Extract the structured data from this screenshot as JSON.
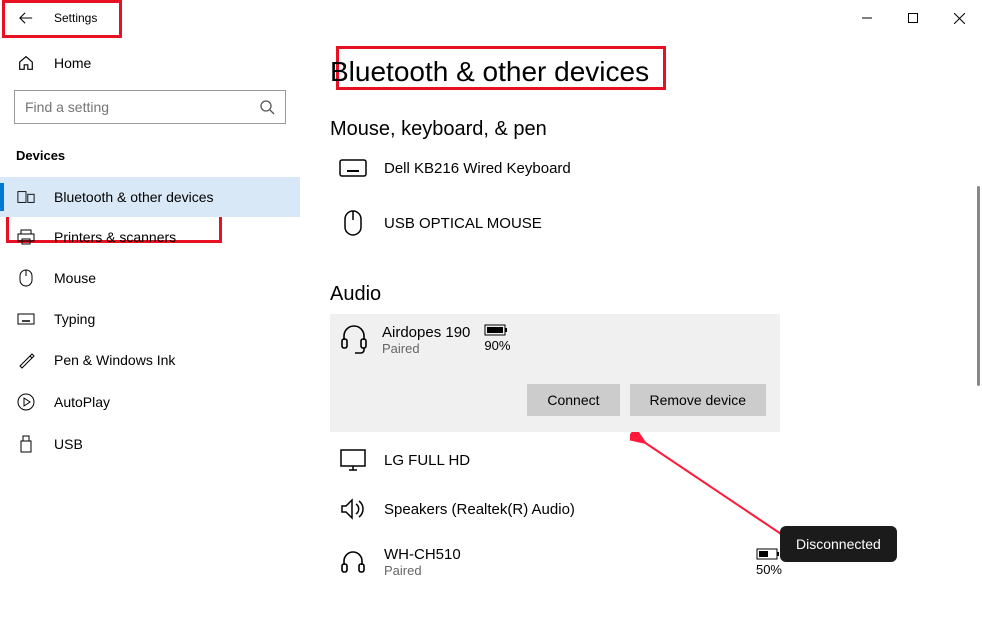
{
  "titlebar": {
    "title": "Settings"
  },
  "sidebar": {
    "home": "Home",
    "search_placeholder": "Find a setting",
    "section": "Devices",
    "items": [
      {
        "label": "Bluetooth & other devices"
      },
      {
        "label": "Printers & scanners"
      },
      {
        "label": "Mouse"
      },
      {
        "label": "Typing"
      },
      {
        "label": "Pen & Windows Ink"
      },
      {
        "label": "AutoPlay"
      },
      {
        "label": "USB"
      }
    ]
  },
  "main": {
    "title": "Bluetooth & other devices",
    "group_mouse": "Mouse, keyboard, & pen",
    "dev_keyboard": "Dell KB216 Wired Keyboard",
    "dev_mouse": "USB OPTICAL MOUSE",
    "group_audio": "Audio",
    "airdopes": {
      "name": "Airdopes 190",
      "status": "Paired",
      "battery": "90%",
      "connect": "Connect",
      "remove": "Remove device"
    },
    "lg": "LG FULL HD",
    "realtek": "Speakers (Realtek(R) Audio)",
    "wh": {
      "name": "WH-CH510",
      "status": "Paired",
      "battery": "50%"
    }
  },
  "annotation": {
    "tooltip": "Disconnected"
  }
}
